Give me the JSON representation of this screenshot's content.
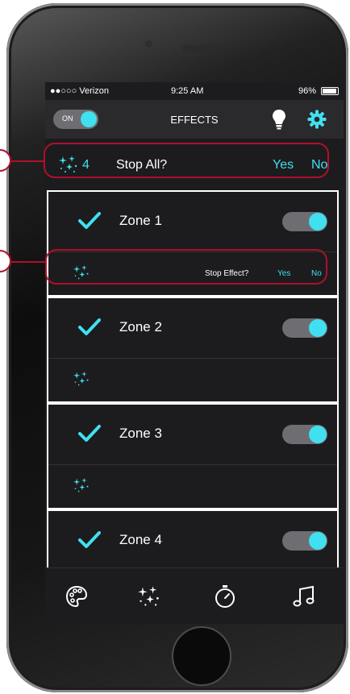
{
  "status_bar": {
    "carrier": "●●○○○ Verizon",
    "time": "9:25 AM",
    "battery": "96%"
  },
  "header": {
    "power_label": "ON",
    "title": "EFFECTS"
  },
  "stop_all": {
    "count": "4",
    "label": "Stop All?",
    "yes": "Yes",
    "no": "No"
  },
  "zones": [
    {
      "name": "Zone 1",
      "enabled": true,
      "stop_label": "Stop Effect?",
      "yes": "Yes",
      "no": "No"
    },
    {
      "name": "Zone 2",
      "enabled": true
    },
    {
      "name": "Zone 3",
      "enabled": true
    },
    {
      "name": "Zone 4",
      "enabled": true
    }
  ],
  "tabs": [
    {
      "icon": "palette-icon"
    },
    {
      "icon": "sparkle-effects-icon"
    },
    {
      "icon": "timer-icon"
    },
    {
      "icon": "music-note-icon"
    }
  ],
  "colors": {
    "accent": "#40e0f0",
    "background": "#1c1c1e",
    "annotation": "#b0102c"
  }
}
